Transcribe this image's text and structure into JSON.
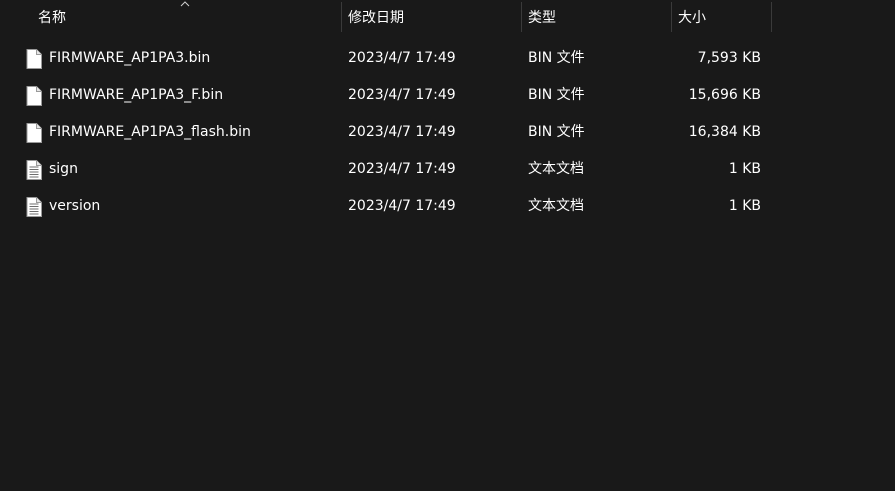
{
  "columns": {
    "name": "名称",
    "date": "修改日期",
    "type": "类型",
    "size": "大小"
  },
  "sort": {
    "column": "name",
    "direction": "ascending",
    "icon": "chevron-up-icon"
  },
  "files": [
    {
      "name": "FIRMWARE_AP1PA3.bin",
      "date": "2023/4/7 17:49",
      "type": "BIN 文件",
      "size": "7,593 KB",
      "icon": "blank-file-icon"
    },
    {
      "name": "FIRMWARE_AP1PA3_F.bin",
      "date": "2023/4/7 17:49",
      "type": "BIN 文件",
      "size": "15,696 KB",
      "icon": "blank-file-icon"
    },
    {
      "name": "FIRMWARE_AP1PA3_flash.bin",
      "date": "2023/4/7 17:49",
      "type": "BIN 文件",
      "size": "16,384 KB",
      "icon": "blank-file-icon"
    },
    {
      "name": "sign",
      "date": "2023/4/7 17:49",
      "type": "文本文档",
      "size": "1 KB",
      "icon": "text-file-icon"
    },
    {
      "name": "version",
      "date": "2023/4/7 17:49",
      "type": "文本文档",
      "size": "1 KB",
      "icon": "text-file-icon"
    }
  ],
  "colors": {
    "background": "#191919",
    "text": "#ffffff",
    "separator": "#3a3a3a"
  }
}
